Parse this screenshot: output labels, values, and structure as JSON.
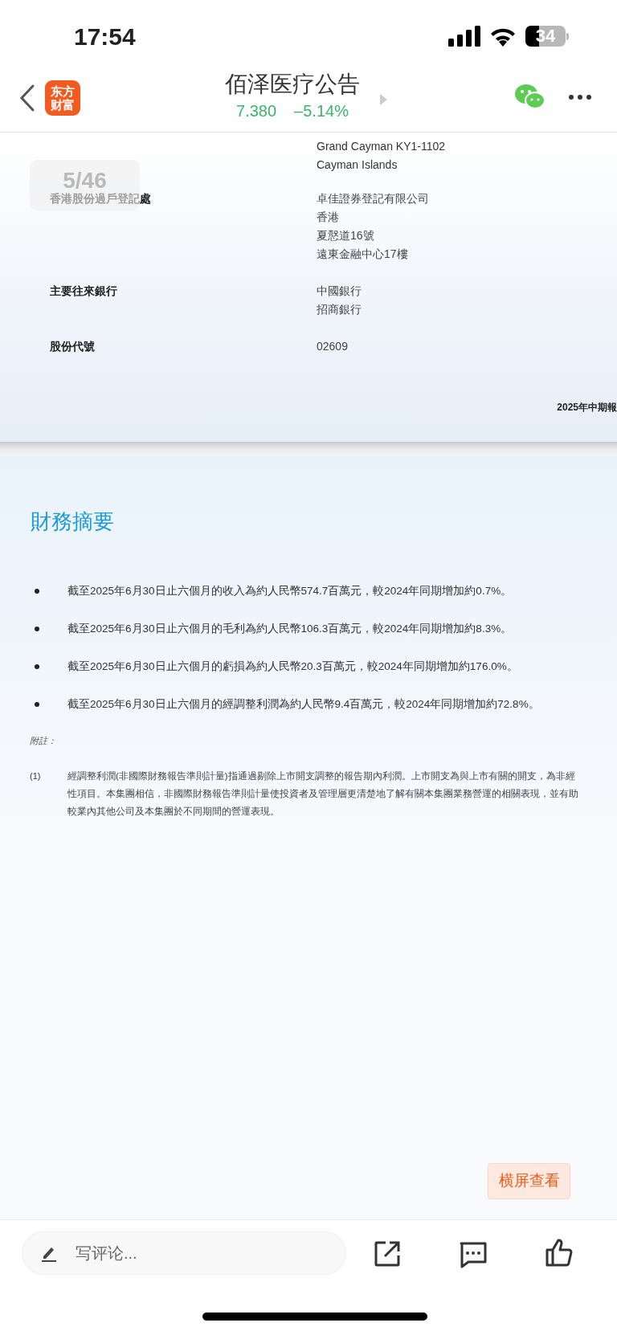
{
  "status_bar": {
    "time": "17:54",
    "battery": "34"
  },
  "header": {
    "logo": [
      "东方",
      "财富"
    ],
    "title": "佰泽医疗公告",
    "price": "7.380",
    "change": "–5.14%"
  },
  "page_indicator": "5/46",
  "document": {
    "address_tail": [
      "Grand Cayman KY1-1102",
      "Cayman Islands"
    ],
    "info_rows": [
      {
        "label": "香港股份過戶登記處",
        "values": [
          "卓佳證券登記有限公司",
          "香港",
          "夏慤道16號",
          "遠東金融中心17樓"
        ]
      },
      {
        "label": "主要往來銀行",
        "values": [
          "中國銀行",
          "招商銀行"
        ]
      },
      {
        "label": "股份代號",
        "values": [
          "02609"
        ]
      }
    ],
    "footer": "2025年中期報"
  },
  "summary": {
    "title": "財務摘要",
    "bullets": [
      "截至2025年6月30日止六個月的收入為約人民幣574.7百萬元，較2024年同期增加約0.7%。",
      "截至2025年6月30日止六個月的毛利為約人民幣106.3百萬元，較2024年同期增加約8.3%。",
      "截至2025年6月30日止六個月的虧損為約人民幣20.3百萬元，較2024年同期增加約176.0%。",
      "截至2025年6月30日止六個月的經調整利潤為約人民幣9.4百萬元，較2024年同期增加約72.8%。"
    ],
    "notes_label": "附註：",
    "notes": [
      {
        "number": "(1)",
        "lines": [
          "經調整利潤(非國際財務報告準則計量)指通過剔除上市開支調整的報告期內利潤。上市開支為與上市有關的開支，為非經",
          "性項目。本集團相信，非國際財務報告準則計量使投資者及管理層更清楚地了解有關本集團業務營運的相關表現，並有助",
          "較業內其他公司及本集團於不同期間的營運表現。"
        ]
      }
    ]
  },
  "landscape_button": "横屏查看",
  "bottom_bar": {
    "comment_placeholder": "写评论..."
  }
}
